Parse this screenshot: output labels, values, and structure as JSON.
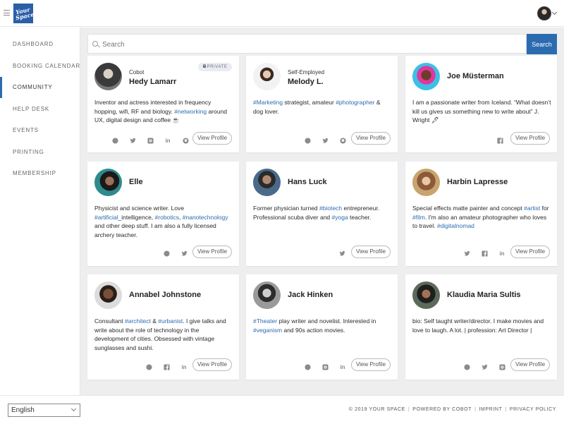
{
  "header": {
    "logo_text_1": "Your",
    "logo_text_2": "Space",
    "menu_icon": "hamburger-icon",
    "user_menu_icon": "chevron-down-icon"
  },
  "sidebar": {
    "items": [
      {
        "label": "DASHBOARD"
      },
      {
        "label": "BOOKING CALENDAR"
      },
      {
        "label": "COMMUNITY",
        "active": true
      },
      {
        "label": "HELP DESK"
      },
      {
        "label": "EVENTS"
      },
      {
        "label": "PRINTING"
      },
      {
        "label": "MEMBERSHIP"
      }
    ]
  },
  "search": {
    "placeholder": "Search",
    "button_label": "Search"
  },
  "colors": {
    "accent": "#2b6cb0",
    "background": "#eeeeee"
  },
  "members": [
    {
      "org": "Cobot",
      "name": "Hedy Lamarr",
      "badge": "PRIVATE",
      "bio_1": "Inventor and actress interested in frequency hopping, wifi, RF and biology. ",
      "tag_1": "#networking",
      "bio_2": " around UX, digital design and coffee ☕",
      "socials": [
        "globe-icon",
        "twitter-icon",
        "instagram-icon",
        "linkedin-icon",
        "github-icon"
      ],
      "view_label": "View Profile"
    },
    {
      "org": "Self-Employed",
      "name": "Melody L.",
      "tag_1": "#Marketing",
      "bio_1": " strategist, amateur ",
      "tag_2": "#photographer",
      "bio_2": " & dog lover.",
      "socials": [
        "globe-icon",
        "twitter-icon",
        "github-icon"
      ],
      "view_label": "View Profile"
    },
    {
      "name": "Joe Müsterman",
      "bio_1": "I am a passionate writer from Iceland. “What doesn’t kill us gives us something new to write about” J. Wright 🖋",
      "socials": [
        "facebook-icon"
      ],
      "view_label": "View Profile"
    },
    {
      "name": "Elle",
      "bio_1": "Physicist and science writer. Love ",
      "tag_1": "#artificial",
      "bio_2": "_intelligence, ",
      "tag_2": "#robotics",
      "bio_3": ", ",
      "tag_3": "#nanotechnology",
      "bio_4": " and other deep stuff. I am also a fully licensed archery teacher.",
      "socials": [
        "globe-icon",
        "twitter-icon"
      ],
      "view_label": "View Profile"
    },
    {
      "name": "Hans Luck",
      "bio_1": "Former physician turned ",
      "tag_1": "#biotech",
      "bio_2": " entrepreneur. Professional scuba diver and ",
      "tag_2": "#yoga",
      "bio_3": " teacher.",
      "socials": [
        "twitter-icon"
      ],
      "view_label": "View Profile"
    },
    {
      "name": "Harbin Lapresse",
      "bio_1": "Special effects matte painter and concept ",
      "tag_1": "#artist",
      "bio_2": " for ",
      "tag_2": "#film",
      "bio_3": ". I'm also an amateur photographer who loves to travel. ",
      "tag_3": "#digitalnomad",
      "socials": [
        "twitter-icon",
        "facebook-icon",
        "linkedin-icon"
      ],
      "view_label": "View Profile"
    },
    {
      "name": "Annabel Johnstone",
      "bio_1": "Consultant ",
      "tag_1": "#architect",
      "bio_2": " & ",
      "tag_2": "#urbanist",
      "bio_3": ". I give talks and write about the role of technology in the development of cities. Obsessed with vintage sunglasses and sushi.",
      "socials": [
        "globe-icon",
        "facebook-icon",
        "linkedin-icon"
      ],
      "view_label": "View Profile"
    },
    {
      "name": "Jack Hinken",
      "tag_1": "#Theater",
      "bio_1": " play writer and novelist. Interested in ",
      "tag_2": "#veganism",
      "bio_2": " and 90s action movies.",
      "socials": [
        "globe-icon",
        "instagram-icon",
        "linkedin-icon"
      ],
      "view_label": "View Profile"
    },
    {
      "name": "Klaudia Maria Sultis",
      "bio_1": "bio: Self taught writer/director. I make movies and love to laugh. A lot. | profession: Art Director |",
      "socials": [
        "globe-icon",
        "twitter-icon",
        "instagram-icon"
      ],
      "view_label": "View Profile"
    }
  ],
  "footer": {
    "language": "English",
    "copyright": "© 2019 YOUR SPACE",
    "powered": "POWERED BY COBOT",
    "imprint": "IMPRINT",
    "privacy": "PRIVACY POLICY"
  }
}
